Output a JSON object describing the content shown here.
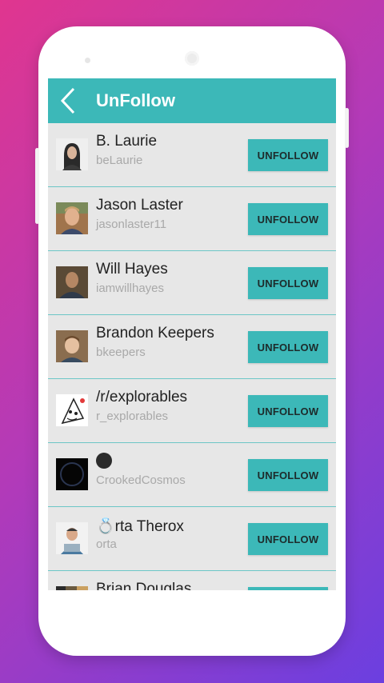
{
  "header": {
    "title": "UnFollow"
  },
  "button_label": "UNFOLLOW",
  "users": [
    {
      "name": "B. Laurie",
      "handle": "beLaurie"
    },
    {
      "name": "Jason Laster",
      "handle": "jasonlaster11"
    },
    {
      "name": "Will Hayes",
      "handle": "iamwillhayes"
    },
    {
      "name": "Brandon Keepers",
      "handle": "bkeepers"
    },
    {
      "name": "/r/explorables",
      "handle": "r_explorables"
    },
    {
      "name": "",
      "handle": "CrookedCosmos"
    },
    {
      "name": "rta Therox",
      "name_prefix": "💍",
      "handle": "orta"
    },
    {
      "name": "Brian Douglas",
      "handle": ""
    }
  ],
  "colors": {
    "accent": "#3cb8b8",
    "background_start": "#e0368f",
    "background_end": "#6b3fe0"
  }
}
